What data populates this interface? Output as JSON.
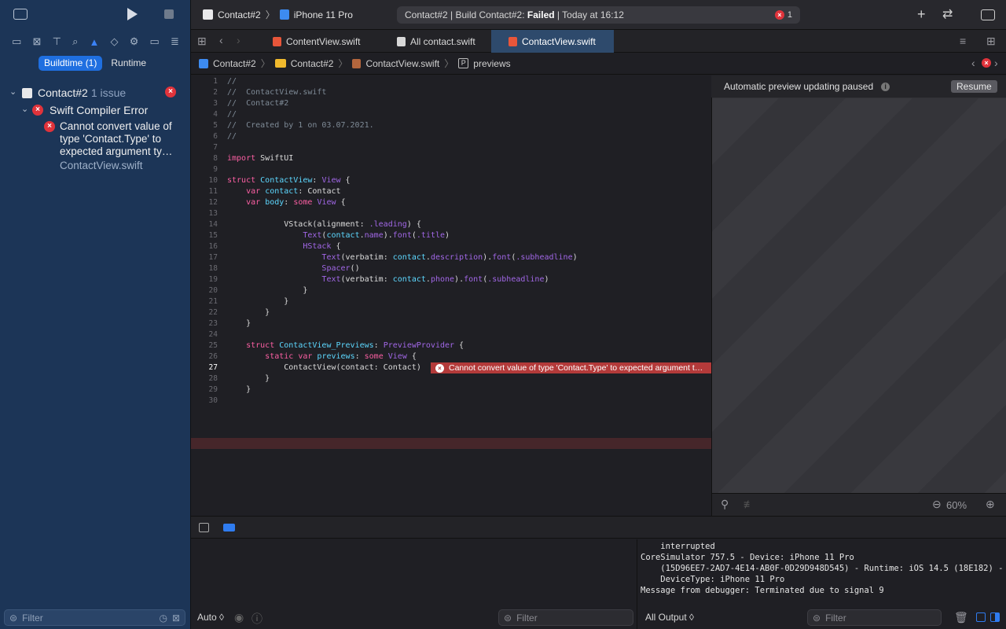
{
  "sidebar": {
    "scope_tabs": [
      "Buildtime (1)",
      "Runtime"
    ],
    "project": {
      "name": "Contact#2",
      "issue_count": "1 issue"
    },
    "group": {
      "name": "Swift Compiler Error"
    },
    "issue": {
      "lines": [
        "Cannot convert value of",
        "type 'Contact.Type' to",
        "expected argument ty…"
      ],
      "file": "ContactView.swift"
    },
    "filter_placeholder": "Filter"
  },
  "toolbar": {
    "scheme": "Contact#2",
    "device": "iPhone 11 Pro",
    "status_prefix": "Contact#2 | Build Contact#2: ",
    "status_result": "Failed",
    "status_suffix": " | Today at 16:12",
    "error_count": "1"
  },
  "tabs": [
    "ContentView.swift",
    "All contact.swift",
    "ContactView.swift"
  ],
  "jumpbar": [
    "Contact#2",
    "Contact#2",
    "ContactView.swift",
    "previews"
  ],
  "editor": {
    "error_message": "Cannot convert value of type 'Contact.Type' to expected argument t…"
  },
  "preview": {
    "status_text": "Automatic preview updating paused",
    "resume_label": "Resume",
    "zoom": "60%"
  },
  "debug": {
    "auto_label": "Auto ◊",
    "filter_placeholder": "Filter",
    "output_label": "All Output ◊",
    "console_text": "    interrupted\nCoreSimulator 757.5 - Device: iPhone 11 Pro\n    (15D96EE7-2AD7-4E14-AB0F-0D29D948D545) - Runtime: iOS 14.5 (18E182) -\n    DeviceType: iPhone 11 Pro\nMessage from debugger: Terminated due to signal 9"
  },
  "colors": {
    "accent": "#1f6fe0",
    "error": "#e0333b",
    "sidebar_bg": "#1c3557"
  }
}
